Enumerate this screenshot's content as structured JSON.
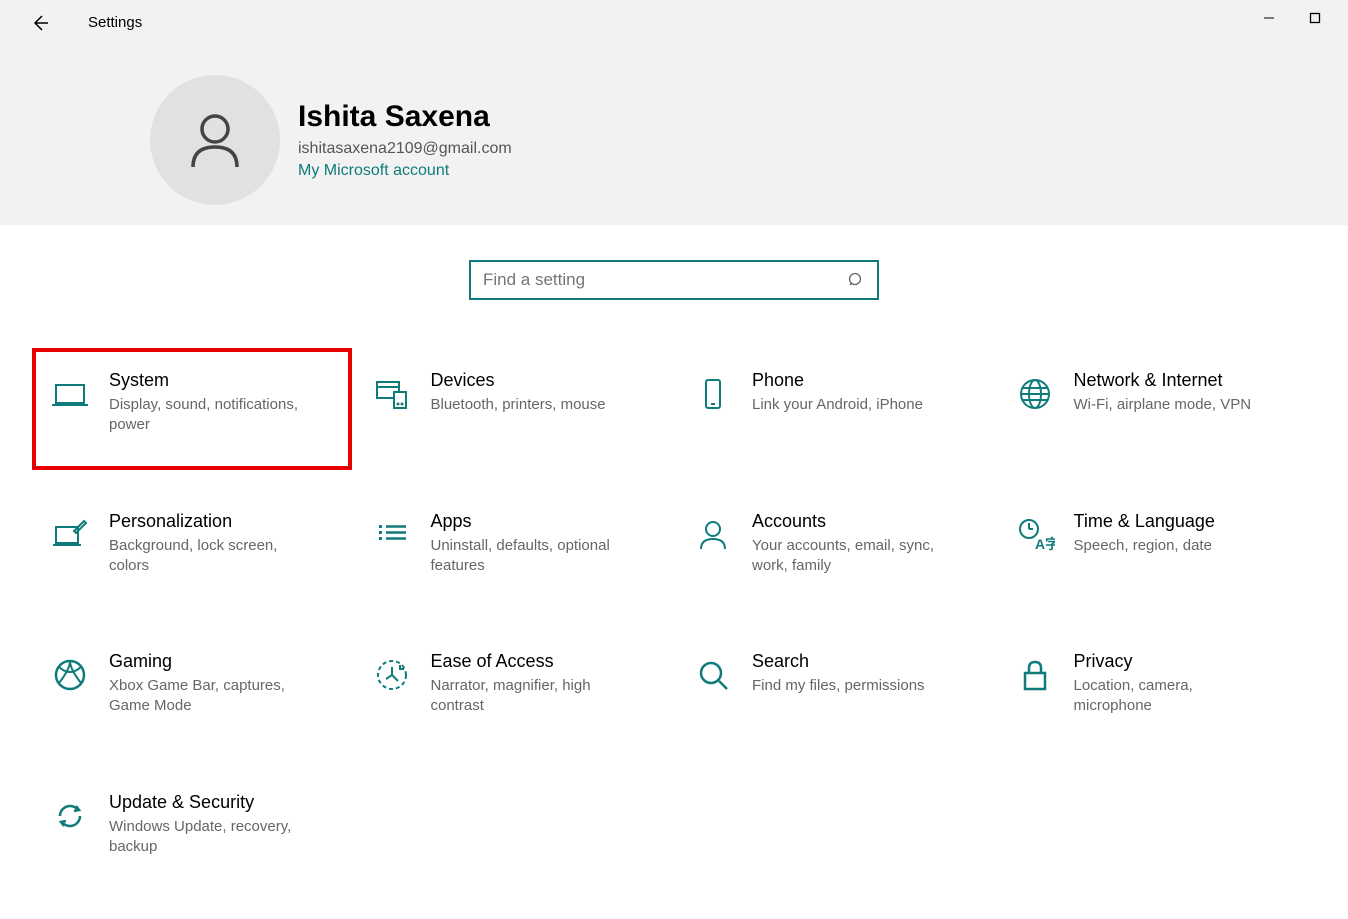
{
  "app": {
    "title": "Settings"
  },
  "profile": {
    "name": "Ishita Saxena",
    "email": "ishitasaxena2109@gmail.com",
    "account_link": "My Microsoft account"
  },
  "search": {
    "placeholder": "Find a setting"
  },
  "tiles": [
    {
      "title": "System",
      "desc": "Display, sound, notifications, power",
      "highlighted": true
    },
    {
      "title": "Devices",
      "desc": "Bluetooth, printers, mouse"
    },
    {
      "title": "Phone",
      "desc": "Link your Android, iPhone"
    },
    {
      "title": "Network & Internet",
      "desc": "Wi-Fi, airplane mode, VPN"
    },
    {
      "title": "Personalization",
      "desc": "Background, lock screen, colors"
    },
    {
      "title": "Apps",
      "desc": "Uninstall, defaults, optional features"
    },
    {
      "title": "Accounts",
      "desc": "Your accounts, email, sync, work, family"
    },
    {
      "title": "Time & Language",
      "desc": "Speech, region, date"
    },
    {
      "title": "Gaming",
      "desc": "Xbox Game Bar, captures, Game Mode"
    },
    {
      "title": "Ease of Access",
      "desc": "Narrator, magnifier, high contrast"
    },
    {
      "title": "Search",
      "desc": "Find my files, permissions"
    },
    {
      "title": "Privacy",
      "desc": "Location, camera, microphone"
    },
    {
      "title": "Update & Security",
      "desc": "Windows Update, recovery, backup"
    }
  ],
  "colors": {
    "accent": "#0f7b7b",
    "highlight": "#e60000"
  }
}
